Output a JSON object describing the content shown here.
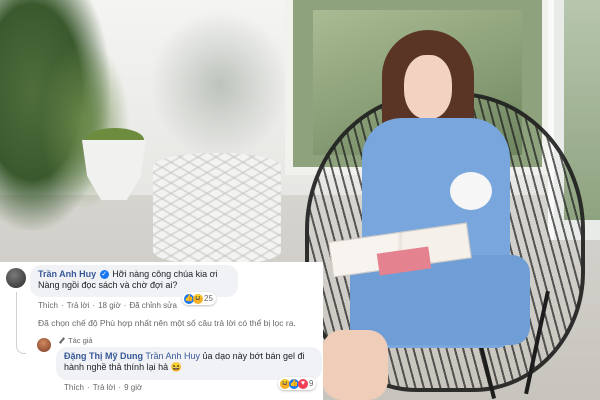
{
  "comments": [
    {
      "author": "Trần Anh Huy",
      "verified": true,
      "lines": [
        "Hỡi nàng công chúa kia ơi",
        "Nàng ngồi đọc sách và chờ đợi ai?"
      ],
      "reactions": {
        "icons": [
          "like-icon",
          "haha-icon"
        ],
        "count": "25"
      },
      "actions": {
        "like": "Thích",
        "reply": "Trả lời",
        "time": "18 giờ",
        "edited": "Đã chỉnh sửa"
      }
    },
    {
      "author_badge": "Tác giả",
      "author": "Đặng Thị Mỹ Dung",
      "mention": "Trần Anh Huy",
      "text_line1": " ủa dạo này bớt bán gel đi",
      "text_line2": "hành nghề thả thính lại hả 😆",
      "reactions": {
        "icons": [
          "haha-icon",
          "like-icon",
          "love-icon"
        ],
        "count": "9"
      },
      "actions": {
        "like": "Thích",
        "reply": "Trả lời",
        "time": "9 giờ"
      }
    }
  ],
  "filter_note": "Đã chọn chế độ Phù hợp nhất nên một số câu trả lời có thể bị lọc ra."
}
